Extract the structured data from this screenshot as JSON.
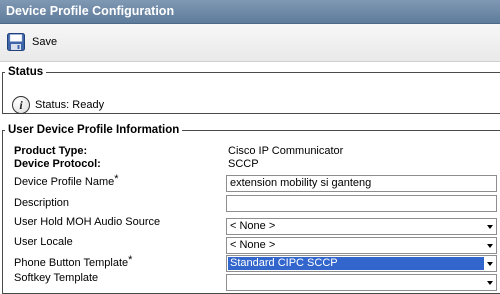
{
  "header": {
    "title": "Device Profile Configuration"
  },
  "toolbar": {
    "save_label": "Save",
    "save_icon": "floppy-disk-icon"
  },
  "status": {
    "legend": "Status",
    "icon": "info-icon",
    "icon_glyph": "i",
    "text": "Status: Ready"
  },
  "profile": {
    "legend": "User Device Profile Information",
    "required_marker": "*",
    "product_type": {
      "label": "Product Type:",
      "value": "Cisco IP Communicator"
    },
    "device_protocol": {
      "label": "Device Protocol:",
      "value": "SCCP"
    },
    "device_profile_name": {
      "label": "Device Profile Name",
      "value": "extension mobility si ganteng"
    },
    "description": {
      "label": "Description",
      "value": ""
    },
    "user_hold_moh": {
      "label": "User Hold MOH Audio Source",
      "value": "< None >"
    },
    "user_locale": {
      "label": "User Locale",
      "value": "< None >"
    },
    "phone_button_template": {
      "label": "Phone Button Template",
      "value": "Standard CIPC SCCP"
    },
    "softkey_template": {
      "label": "Softkey Template"
    }
  }
}
